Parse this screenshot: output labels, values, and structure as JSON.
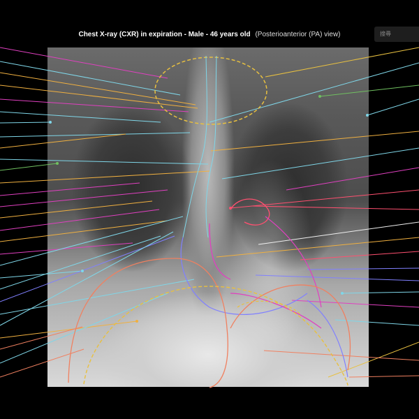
{
  "header": {
    "title": "Chest X-ray (CXR) in expiration - Male - 46 years old",
    "view": "(Posterioanterior (PA) view)"
  },
  "search": {
    "placeholder": "搜尋"
  },
  "image": {
    "icon": "chest-xray-image"
  },
  "colors": {
    "pink": "#e040c0",
    "cyan": "#7fd6e8",
    "orange": "#f0b040",
    "yellow": "#e8c040",
    "red": "#ff5070",
    "green": "#70c060",
    "violet": "#8080ff",
    "salmon": "#f08060"
  }
}
